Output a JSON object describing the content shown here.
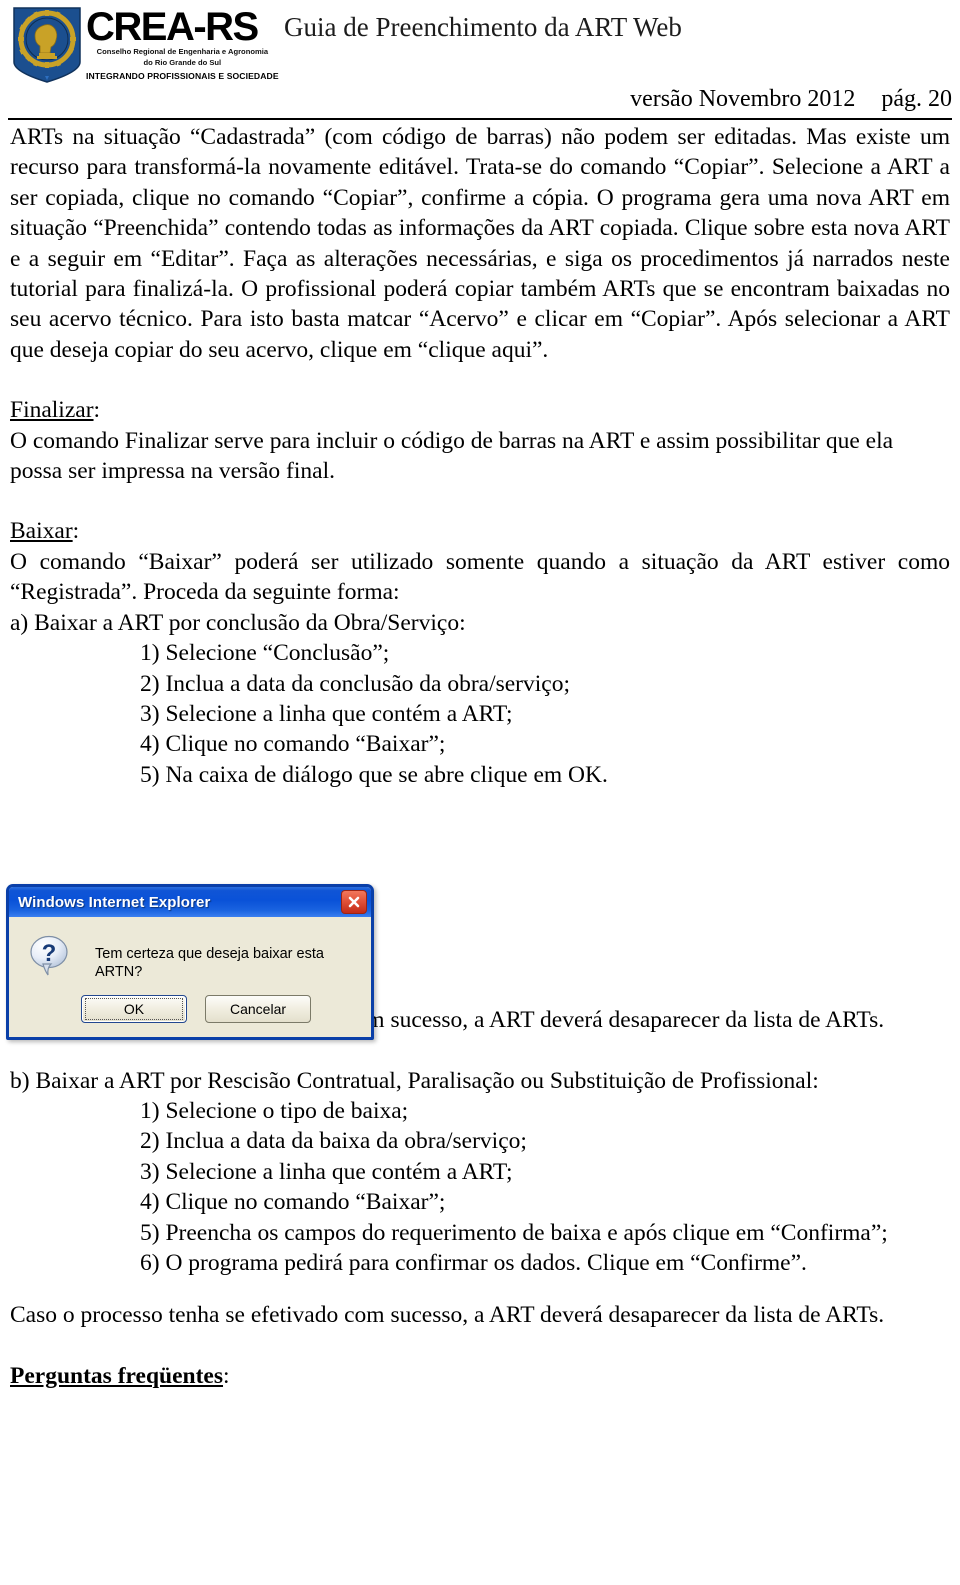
{
  "header": {
    "logo": {
      "wordmark": "CREA-RS",
      "subtitle_line1": "Conselho Regional de Engenharia e Agronomia",
      "subtitle_line2": "do Rio Grande do Sul",
      "tagline": "INTEGRANDO PROFISSIONAIS E SOCIEDADE",
      "shield_blue": "#1b4f8f",
      "gear_gold": "#c9a227"
    },
    "doc_title": "Guia de Preenchimento da ART Web",
    "version": "versão Novembro 2012",
    "page_label": "pág. 20"
  },
  "body": {
    "paragraph_1": "ARTs na situação “Cadastrada” (com código de barras) não podem ser editadas. Mas existe um recurso para transformá-la novamente editável. Trata-se do comando “Copiar”. Selecione a ART a ser copiada, clique no comando “Copiar”, confirme a cópia. O programa gera uma nova ART em situação “Preenchida” contendo todas as informações da ART copiada. Clique sobre esta nova ART e a seguir em “Editar”. Faça as alterações necessárias, e siga os procedimentos já narrados neste tutorial para finalizá-la. O profissional poderá copiar também ARTs que se encontram baixadas no seu acervo técnico. Para isto basta matcar “Acervo” e clicar em “Copiar”. Após selecionar a ART que deseja copiar do seu acervo, clique em “clique aqui”.",
    "finalizar_heading": "Finalizar",
    "finalizar_heading_colon": ":",
    "finalizar_text": "O comando Finalizar serve para incluir o código de barras na ART e assim possibilitar que ela possa ser impressa na versão final.",
    "baixar_heading": "Baixar",
    "baixar_heading_colon": ":",
    "baixar_text": "O comando “Baixar” poderá ser utilizado somente quando a situação da ART estiver como “Registrada”. Proceda da seguinte forma:",
    "item_a_label": "a) Baixar a ART por conclusão da Obra/Serviço:",
    "item_a_steps": [
      "1) Selecione “Conclusão”;",
      "2) Inclua a data da conclusão da obra/serviço;",
      "3) Selecione a linha que contém a ART;",
      "4) Clique no comando “Baixar”;",
      "5) Na caixa de diálogo que se abre clique em OK."
    ],
    "after_dialog_text": "Caso o processo tenha se efetivado com sucesso, a ART deverá desaparecer da lista de ARTs.",
    "item_b_label": "b) Baixar a ART por Rescisão Contratual, Paralisação ou Substituição de Profissional:",
    "item_b_steps": [
      "1) Selecione o tipo de baixa;",
      "2) Inclua a data da baixa da obra/serviço;",
      "3) Selecione a linha que contém a ART;",
      "4) Clique no comando “Baixar”;",
      "5) Preencha os campos do requerimento de baixa e após clique em “Confirma”;",
      "6) O programa pedirá para confirmar os dados. Clique em “Confirme”."
    ],
    "closing_text": "Caso o processo tenha se efetivado com sucesso, a ART deverá desaparecer da lista de ARTs.",
    "faq_heading": "Perguntas freqüentes",
    "faq_heading_colon": ":"
  },
  "dialog": {
    "title": "Windows Internet Explorer",
    "message": "Tem certeza que deseja baixar esta ARTN?",
    "ok_label": "OK",
    "cancel_label": "Cancelar",
    "close_icon": "close-icon",
    "icon": "question-bubble-icon",
    "titlebar_color": "#0a52d8",
    "body_color": "#ece9d8",
    "close_color": "#c22b18"
  }
}
